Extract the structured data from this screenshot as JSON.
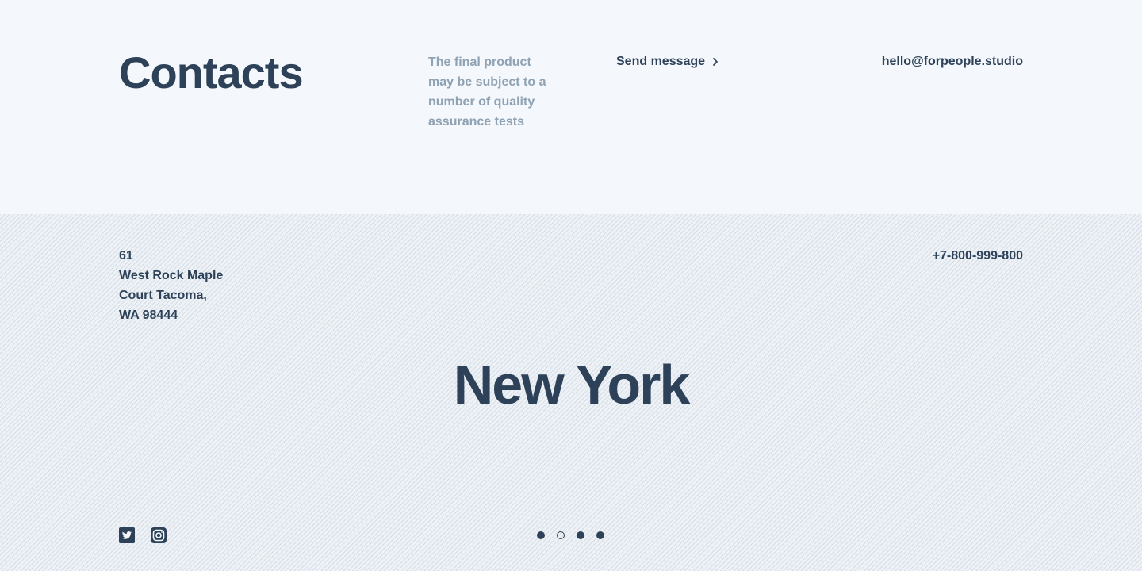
{
  "header": {
    "title": "Contacts",
    "note": "The final product may be subject to a number of quality assurance tests",
    "send_message_label": "Send message",
    "send_message_icon": "chevron-right-icon",
    "email": "hello@forpeople.studio"
  },
  "location": {
    "address_lines": [
      "61",
      "West Rock Maple",
      "Court Tacoma,",
      "WA 98444"
    ],
    "phone": "+7-800-999-800",
    "city": "New York"
  },
  "social": [
    {
      "name": "twitter",
      "icon": "twitter-icon"
    },
    {
      "name": "instagram",
      "icon": "instagram-icon"
    }
  ],
  "pagination": {
    "total": 4,
    "active_index": 1
  },
  "colors": {
    "text": "#2d4258",
    "muted": "#8fa2b4",
    "top_background": "#f4f7fb",
    "bottom_background": "#eef2f6"
  }
}
